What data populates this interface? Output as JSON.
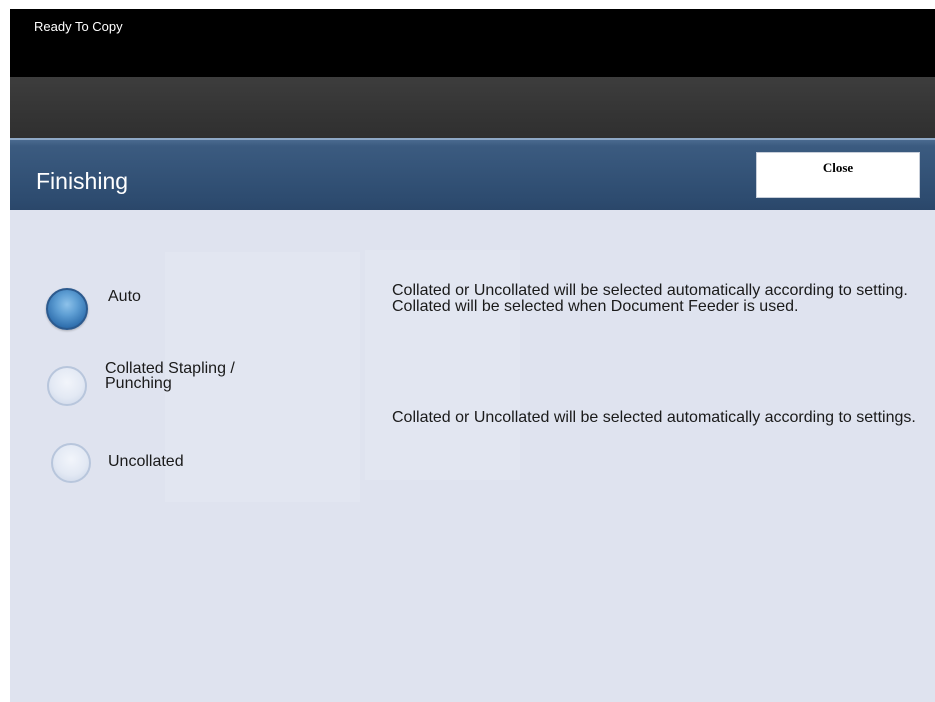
{
  "status": {
    "text": "Ready To Copy"
  },
  "header": {
    "title": "Finishing",
    "close_label": "Close"
  },
  "options": [
    {
      "label": "Auto",
      "selected": true
    },
    {
      "label": "Collated Stapling / Punching",
      "line1": "Collated Stapling /",
      "line2": "Punching",
      "selected": false
    },
    {
      "label": "Uncollated",
      "selected": false
    }
  ],
  "descriptions": [
    "Collated or Uncollated will be selected automatically according to setting.  Collated will be selected when Document Feeder is used.",
    "Collated or Uncollated will be selected automatically according to settings."
  ],
  "colors": {
    "header_blue": "#2d4b6f",
    "radio_selected": "#3f86c8",
    "background": "#dfe3ef"
  }
}
